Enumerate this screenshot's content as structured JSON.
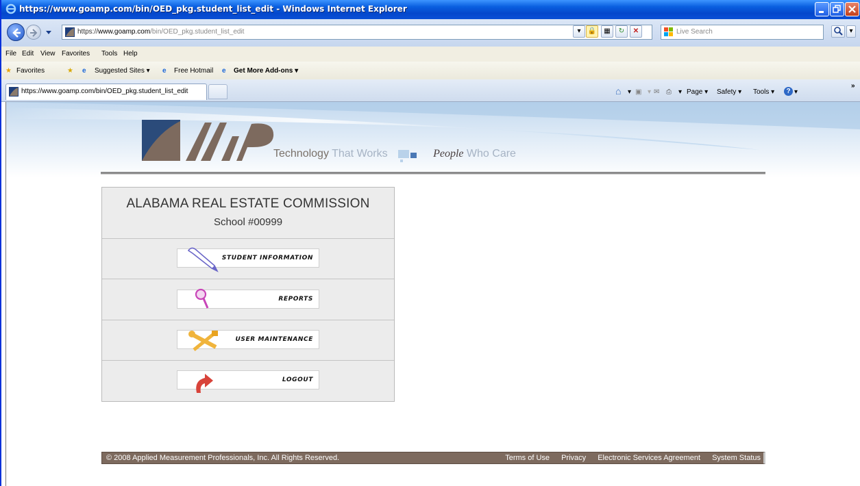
{
  "window": {
    "title": "https://www.goamp.com/bin/OED_pkg.student_list_edit - Windows Internet Explorer"
  },
  "address": {
    "url_scheme": "https://",
    "url_host": "www.goamp.com",
    "url_path": "/bin/OED_pkg.student_list_edit",
    "search_placeholder": "Live Search"
  },
  "menubar": [
    "File",
    "Edit",
    "View",
    "Favorites",
    "Tools",
    "Help"
  ],
  "favorites_bar": {
    "favorites": "Favorites",
    "suggested": "Suggested Sites ▾",
    "hotmail": "Free Hotmail",
    "addons": "Get More Add-ons ▾"
  },
  "tab": {
    "label": "https://www.goamp.com/bin/OED_pkg.student_list_edit"
  },
  "commandbar": {
    "page": "Page ▾",
    "safety": "Safety ▾",
    "tools": "Tools ▾"
  },
  "banner": {
    "tag_technology": "Technology",
    "tag_that_works": " That Works",
    "tag_people": "People",
    "tag_who_care": " Who Care"
  },
  "panel": {
    "agency": "ALABAMA REAL ESTATE COMMISSION",
    "school": "School #00999",
    "items": [
      {
        "label": "STUDENT INFORMATION",
        "icon": "pen-icon"
      },
      {
        "label": "REPORTS",
        "icon": "magnifier-icon"
      },
      {
        "label": "USER MAINTENANCE",
        "icon": "tools-icon"
      },
      {
        "label": "LOGOUT",
        "icon": "logout-arrow-icon"
      }
    ]
  },
  "footer": {
    "copyright": "© 2008 Applied Measurement Professionals, Inc. All Rights Reserved.",
    "links": [
      "Terms of Use",
      "Privacy",
      "Electronic Services Agreement",
      "System Status"
    ]
  },
  "colors": {
    "title_blue": "#0a5fe0",
    "footer_brown": "#7d6a5e",
    "panel_gray": "#ececec"
  }
}
